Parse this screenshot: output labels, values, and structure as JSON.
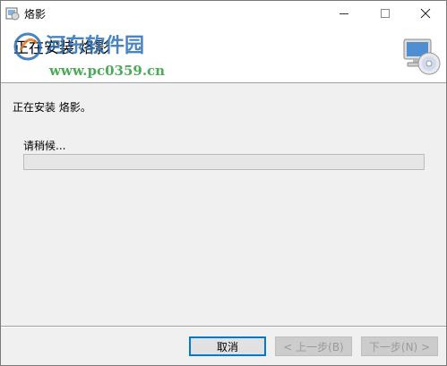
{
  "window": {
    "title": "烙影",
    "minimize_icon": "minimize-icon",
    "maximize_icon": "maximize-icon",
    "close_icon": "close-icon"
  },
  "banner": {
    "title": "正在安装 烙影",
    "watermark_line1": "河东软件园",
    "watermark_line2": "www.pc0359.cn",
    "icon": "computer-cd-icon"
  },
  "body": {
    "status_text": "正在安装 烙影。",
    "wait_label": "请稍候...",
    "progress": 0
  },
  "footer": {
    "cancel_label": "取消",
    "back_label": "< 上一步(B)",
    "next_label": "下一步(N) >"
  },
  "colors": {
    "accent": "#0078d7",
    "watermark": "#2a6fb6"
  }
}
